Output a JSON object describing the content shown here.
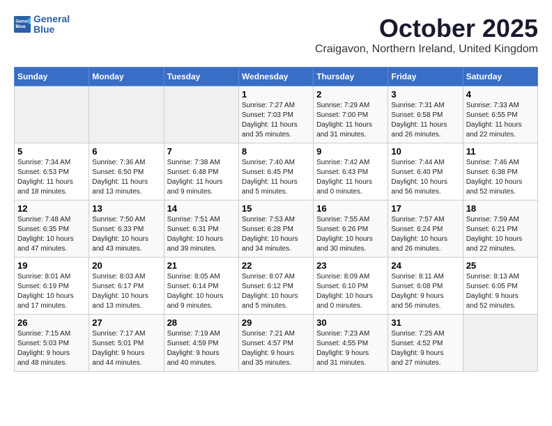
{
  "logo": {
    "line1": "General",
    "line2": "Blue"
  },
  "title": "October 2025",
  "subtitle": "Craigavon, Northern Ireland, United Kingdom",
  "days_header": [
    "Sunday",
    "Monday",
    "Tuesday",
    "Wednesday",
    "Thursday",
    "Friday",
    "Saturday"
  ],
  "weeks": [
    [
      {
        "num": "",
        "content": ""
      },
      {
        "num": "",
        "content": ""
      },
      {
        "num": "",
        "content": ""
      },
      {
        "num": "1",
        "content": "Sunrise: 7:27 AM\nSunset: 7:03 PM\nDaylight: 11 hours\nand 35 minutes."
      },
      {
        "num": "2",
        "content": "Sunrise: 7:29 AM\nSunset: 7:00 PM\nDaylight: 11 hours\nand 31 minutes."
      },
      {
        "num": "3",
        "content": "Sunrise: 7:31 AM\nSunset: 6:58 PM\nDaylight: 11 hours\nand 26 minutes."
      },
      {
        "num": "4",
        "content": "Sunrise: 7:33 AM\nSunset: 6:55 PM\nDaylight: 11 hours\nand 22 minutes."
      }
    ],
    [
      {
        "num": "5",
        "content": "Sunrise: 7:34 AM\nSunset: 6:53 PM\nDaylight: 11 hours\nand 18 minutes."
      },
      {
        "num": "6",
        "content": "Sunrise: 7:36 AM\nSunset: 6:50 PM\nDaylight: 11 hours\nand 13 minutes."
      },
      {
        "num": "7",
        "content": "Sunrise: 7:38 AM\nSunset: 6:48 PM\nDaylight: 11 hours\nand 9 minutes."
      },
      {
        "num": "8",
        "content": "Sunrise: 7:40 AM\nSunset: 6:45 PM\nDaylight: 11 hours\nand 5 minutes."
      },
      {
        "num": "9",
        "content": "Sunrise: 7:42 AM\nSunset: 6:43 PM\nDaylight: 11 hours\nand 0 minutes."
      },
      {
        "num": "10",
        "content": "Sunrise: 7:44 AM\nSunset: 6:40 PM\nDaylight: 10 hours\nand 56 minutes."
      },
      {
        "num": "11",
        "content": "Sunrise: 7:46 AM\nSunset: 6:38 PM\nDaylight: 10 hours\nand 52 minutes."
      }
    ],
    [
      {
        "num": "12",
        "content": "Sunrise: 7:48 AM\nSunset: 6:35 PM\nDaylight: 10 hours\nand 47 minutes."
      },
      {
        "num": "13",
        "content": "Sunrise: 7:50 AM\nSunset: 6:33 PM\nDaylight: 10 hours\nand 43 minutes."
      },
      {
        "num": "14",
        "content": "Sunrise: 7:51 AM\nSunset: 6:31 PM\nDaylight: 10 hours\nand 39 minutes."
      },
      {
        "num": "15",
        "content": "Sunrise: 7:53 AM\nSunset: 6:28 PM\nDaylight: 10 hours\nand 34 minutes."
      },
      {
        "num": "16",
        "content": "Sunrise: 7:55 AM\nSunset: 6:26 PM\nDaylight: 10 hours\nand 30 minutes."
      },
      {
        "num": "17",
        "content": "Sunrise: 7:57 AM\nSunset: 6:24 PM\nDaylight: 10 hours\nand 26 minutes."
      },
      {
        "num": "18",
        "content": "Sunrise: 7:59 AM\nSunset: 6:21 PM\nDaylight: 10 hours\nand 22 minutes."
      }
    ],
    [
      {
        "num": "19",
        "content": "Sunrise: 8:01 AM\nSunset: 6:19 PM\nDaylight: 10 hours\nand 17 minutes."
      },
      {
        "num": "20",
        "content": "Sunrise: 8:03 AM\nSunset: 6:17 PM\nDaylight: 10 hours\nand 13 minutes."
      },
      {
        "num": "21",
        "content": "Sunrise: 8:05 AM\nSunset: 6:14 PM\nDaylight: 10 hours\nand 9 minutes."
      },
      {
        "num": "22",
        "content": "Sunrise: 8:07 AM\nSunset: 6:12 PM\nDaylight: 10 hours\nand 5 minutes."
      },
      {
        "num": "23",
        "content": "Sunrise: 8:09 AM\nSunset: 6:10 PM\nDaylight: 10 hours\nand 0 minutes."
      },
      {
        "num": "24",
        "content": "Sunrise: 8:11 AM\nSunset: 6:08 PM\nDaylight: 9 hours\nand 56 minutes."
      },
      {
        "num": "25",
        "content": "Sunrise: 8:13 AM\nSunset: 6:05 PM\nDaylight: 9 hours\nand 52 minutes."
      }
    ],
    [
      {
        "num": "26",
        "content": "Sunrise: 7:15 AM\nSunset: 5:03 PM\nDaylight: 9 hours\nand 48 minutes."
      },
      {
        "num": "27",
        "content": "Sunrise: 7:17 AM\nSunset: 5:01 PM\nDaylight: 9 hours\nand 44 minutes."
      },
      {
        "num": "28",
        "content": "Sunrise: 7:19 AM\nSunset: 4:59 PM\nDaylight: 9 hours\nand 40 minutes."
      },
      {
        "num": "29",
        "content": "Sunrise: 7:21 AM\nSunset: 4:57 PM\nDaylight: 9 hours\nand 35 minutes."
      },
      {
        "num": "30",
        "content": "Sunrise: 7:23 AM\nSunset: 4:55 PM\nDaylight: 9 hours\nand 31 minutes."
      },
      {
        "num": "31",
        "content": "Sunrise: 7:25 AM\nSunset: 4:52 PM\nDaylight: 9 hours\nand 27 minutes."
      },
      {
        "num": "",
        "content": ""
      }
    ]
  ]
}
